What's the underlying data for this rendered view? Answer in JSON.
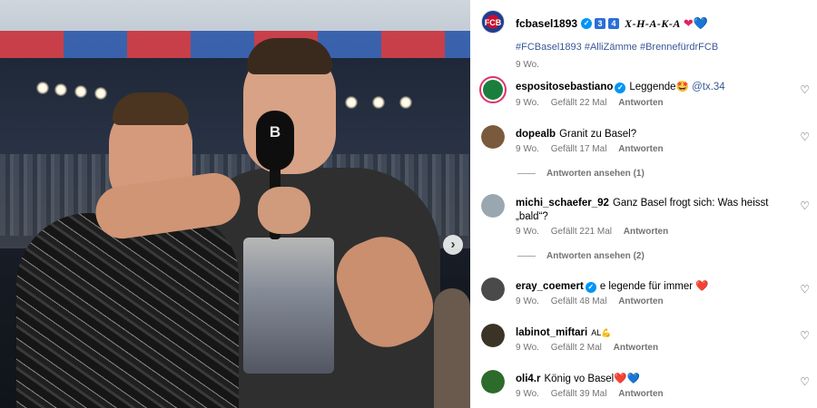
{
  "post": {
    "author": "fcbasel1893",
    "title_badges": [
      "3",
      "4"
    ],
    "title_text": "X-H-A-K-A",
    "title_hearts": [
      "❤",
      "💙"
    ],
    "hashtags": "#FCBasel1893 #AlliZämme #BrennefürdrFCB",
    "time": "9 Wo.",
    "next_button": "›"
  },
  "comments": [
    {
      "user": "espositosebastiano",
      "verified": true,
      "text": "Leggende🤩",
      "mention": "@tx.34",
      "time": "9 Wo.",
      "likes": "Gefällt 22 Mal",
      "reply": "Antworten",
      "avatar_color": "#1a7f3c",
      "story": true
    },
    {
      "user": "dopealb",
      "verified": false,
      "text": "Granit zu Basel?",
      "time": "9 Wo.",
      "likes": "Gefällt 17 Mal",
      "reply": "Antworten",
      "avatar_color": "#7a5a3c",
      "view_replies": "Antworten ansehen (1)"
    },
    {
      "user": "michi_schaefer_92",
      "verified": false,
      "text": "Ganz Basel frogt sich: Was heisst „bald“?",
      "time": "9 Wo.",
      "likes": "Gefällt 221 Mal",
      "reply": "Antworten",
      "avatar_color": "#9aa7b0",
      "view_replies": "Antworten ansehen (2)"
    },
    {
      "user": "eray_coemert",
      "verified": true,
      "text": "e legende für immer ❤️",
      "time": "9 Wo.",
      "likes": "Gefällt 48 Mal",
      "reply": "Antworten",
      "avatar_color": "#4a4a4a"
    },
    {
      "user": "labinot_miftari",
      "verified": false,
      "text": "AL💪",
      "time": "9 Wo.",
      "likes": "Gefällt 2 Mal",
      "reply": "Antworten",
      "avatar_color": "#3b3326"
    },
    {
      "user": "oli4.r",
      "verified": false,
      "text": "König vo Basel❤️💙",
      "time": "9 Wo.",
      "likes": "Gefällt 39 Mal",
      "reply": "Antworten",
      "avatar_color": "#2d6b2a"
    }
  ],
  "icons": {
    "like": "heart-outline-icon",
    "verified": "verified-badge-icon",
    "next": "chevron-right-icon"
  },
  "colors": {
    "link": "#385898",
    "meta": "#737373",
    "verified": "#0095f6",
    "heart_red": "#e0245e",
    "heart_blue": "#2a6fd6"
  }
}
